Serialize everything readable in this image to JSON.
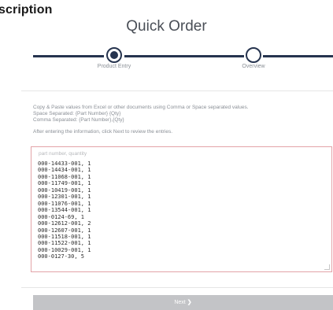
{
  "header": {
    "fragment_title": "scription",
    "page_title": "Quick Order"
  },
  "wizard": {
    "steps": [
      {
        "label": "Product Entry",
        "state": "current"
      },
      {
        "label": "Overview",
        "state": "upcoming"
      }
    ]
  },
  "instructions": {
    "line1": "Copy & Paste values from Excel or other documents using Comma or Space separated values.",
    "line2": "Space Separated: {Part Number} {Qty}",
    "line3": "Comma Separated: {Part Number},{Qty}",
    "line4": "After entering the information, click Next to review the entries."
  },
  "entry": {
    "placeholder": "part number, quantity",
    "lines": [
      "000-14433-001, 1",
      "000-14434-001, 1",
      "000-11068-001, 1",
      "000-11749-001, 1",
      "000-10419-001, 1",
      "000-12301-001, 1",
      "000-11076-001, 1",
      "000-13544-001, 1",
      "000-0124-69, 1",
      "000-12612-001, 2",
      "000-12607-001, 1",
      "000-11518-001, 1",
      "000-11522-001, 1",
      "000-10029-001, 1",
      "000-0127-30, 5"
    ]
  },
  "actions": {
    "next_label": "Next",
    "next_icon": "chevron-right-icon"
  },
  "colors": {
    "accent": "#26344f",
    "entry_border": "#e3a3a8",
    "button_bg": "#c3c4c7"
  }
}
